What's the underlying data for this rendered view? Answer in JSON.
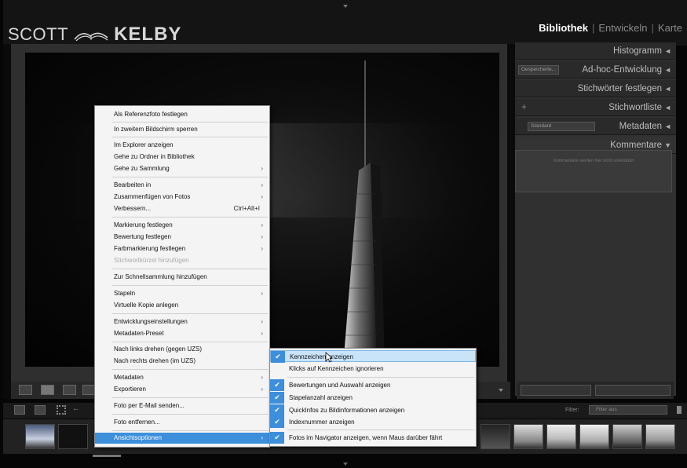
{
  "brand": {
    "logo_left": "SCOTT",
    "logo_right": "KELBY"
  },
  "modules": {
    "active": "Bibliothek",
    "items": [
      "Entwickeln",
      "Karte"
    ],
    "separator": "|"
  },
  "right_panel": {
    "rows": [
      {
        "label": "Histogramm",
        "arrow": "◄"
      },
      {
        "label": "Ad-hoc-Entwicklung",
        "arrow": "◄",
        "mini": "Gespeicherte..."
      },
      {
        "label": "Stichwörter festlegen",
        "arrow": "◄"
      },
      {
        "label": "Stichwortliste",
        "arrow": "◄",
        "plus": "+"
      },
      {
        "label": "Metadaten",
        "arrow": "◄",
        "mini": "Standard"
      },
      {
        "label": "Kommentare",
        "arrow": "▼"
      }
    ],
    "comment_placeholder": "Kommentare werden hier nicht unterstützt"
  },
  "filmstrip": {
    "filter_label": "Filter:",
    "filter_value": "Filter aus"
  },
  "context_menu": {
    "items": [
      {
        "label": "Als Referenzfoto festlegen"
      },
      {
        "label": "In zweitem Bildschirm sperren"
      },
      {
        "label": "Im Explorer anzeigen"
      },
      {
        "label": "Gehe zu Ordner in Bibliothek"
      },
      {
        "label": "Gehe zu Sammlung",
        "submenu": true
      },
      {
        "label": "Bearbeiten in",
        "submenu": true
      },
      {
        "label": "Zusammenfügen von Fotos",
        "submenu": true
      },
      {
        "label": "Verbessern...",
        "shortcut": "Ctrl+Alt+I"
      },
      {
        "label": "Markierung festlegen",
        "submenu": true
      },
      {
        "label": "Bewertung festlegen",
        "submenu": true
      },
      {
        "label": "Farbmarkierung festlegen",
        "submenu": true
      },
      {
        "label": "Stichwortkürzel hinzufügen",
        "disabled": true
      },
      {
        "label": "Zur Schnellsammlung hinzufügen"
      },
      {
        "label": "Stapeln",
        "submenu": true
      },
      {
        "label": "Virtuelle Kopie anlegen"
      },
      {
        "label": "Entwicklungseinstellungen",
        "submenu": true
      },
      {
        "label": "Metadaten-Preset",
        "submenu": true
      },
      {
        "label": "Nach links drehen (gegen UZS)"
      },
      {
        "label": "Nach rechts drehen (im UZS)"
      },
      {
        "label": "Metadaten",
        "submenu": true
      },
      {
        "label": "Exportieren",
        "submenu": true
      },
      {
        "label": "Foto per E-Mail senden..."
      },
      {
        "label": "Foto entfernen..."
      },
      {
        "label": "Ansichtsoptionen",
        "submenu": true,
        "highlighted": true
      }
    ],
    "submenu_arrow": "›"
  },
  "view_options_submenu": {
    "items": [
      {
        "label": "Kennzeichen anzeigen",
        "checked": true,
        "highlighted": true
      },
      {
        "label": "Klicks auf Kennzeichen ignorieren",
        "checked": false
      },
      {
        "label": "Bewertungen und Auswahl anzeigen",
        "checked": true
      },
      {
        "label": "Stapelanzahl anzeigen",
        "checked": true
      },
      {
        "label": "QuickInfos zu Bildinformationen anzeigen",
        "checked": true
      },
      {
        "label": "Indexnummer anzeigen",
        "checked": true
      },
      {
        "label": "Fotos im Navigator anzeigen, wenn Maus darüber fährt",
        "checked": true
      }
    ],
    "check_glyph": "✔"
  }
}
